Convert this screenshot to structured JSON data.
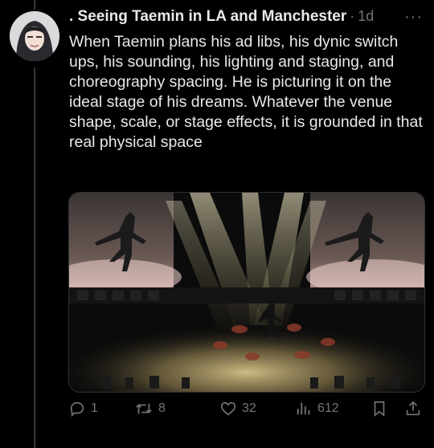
{
  "tweet": {
    "author_name": ". Seeing Taemin in LA and Manchester",
    "separator": "·",
    "time": "1d",
    "more_label": "···",
    "text": "When Taemin plans his ad libs, his dynic switch ups, his sounding, his lighting and staging, and choreography spacing. He is picturing it on the ideal stage of his dreams. Whatever the venue shape, scale, or stage effects, it is grounded in that real physical space"
  },
  "actions": {
    "replies": "1",
    "reposts": "8",
    "likes": "32",
    "views": "612"
  },
  "colors": {
    "background": "#000000",
    "text": "#e7e9ea",
    "secondary": "#71767b",
    "thread_line": "#333639"
  },
  "icons": [
    "reply-icon",
    "repost-icon",
    "like-icon",
    "views-icon",
    "bookmark-icon",
    "share-icon",
    "more-icon"
  ]
}
